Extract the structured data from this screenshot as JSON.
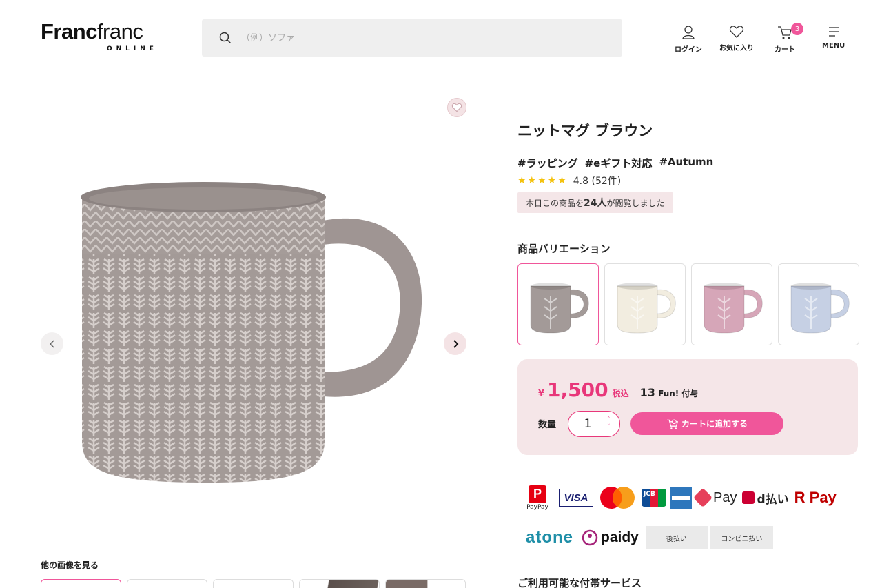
{
  "header": {
    "logo_main_bold": "Franc",
    "logo_main_light": "franc",
    "logo_sub": "ONLINE",
    "search_placeholder": "（例）ソファ",
    "nav": {
      "login": "ログイン",
      "favorites": "お気に入り",
      "cart": "カート",
      "cart_count": "3",
      "menu": "MENU"
    }
  },
  "gallery": {
    "other_images_label": "他の画像を見る"
  },
  "product": {
    "title": "ニットマグ ブラウン",
    "tags": [
      "#ラッピング",
      "#eギフト対応",
      "#Autumn"
    ],
    "stars": "★★★★★",
    "rating": "4.8",
    "review_count": "(52件)",
    "viewed_prefix": "本日この商品を",
    "viewed_count": "24人",
    "viewed_suffix": "が閲覧しました",
    "variations_title": "商品バリエーション",
    "variation_colors": [
      "#a39a98",
      "#f2ede0",
      "#d6a6b8",
      "#c6d0e4"
    ],
    "currency": "¥",
    "price": "1,500",
    "tax_label": "税込",
    "fun_points": "13",
    "fun_label": "Fun! 付与",
    "quantity_label": "数量",
    "quantity": "1",
    "add_to_cart": "カートに追加する"
  },
  "payments": {
    "paypay": "PayPay",
    "visa": "VISA",
    "jcb": "JCB",
    "apple_pay": "Pay",
    "d_barai": "d払い",
    "r_pay": "R Pay",
    "atone": "atone",
    "paidy": "paidy",
    "atobarai": "後払い",
    "convenience": "コンビニ払い"
  },
  "services_title": "ご利用可能な付帯サービス",
  "colors": {
    "accent": "#f0569a",
    "price": "#e8377a",
    "price_box_bg": "#f5e6e8"
  }
}
